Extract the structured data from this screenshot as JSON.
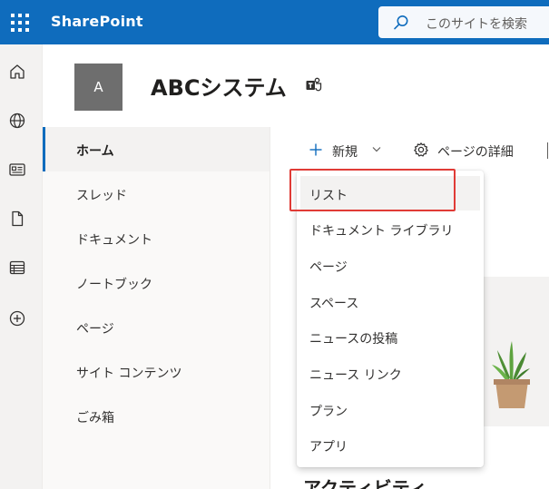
{
  "app": {
    "name": "SharePoint"
  },
  "search": {
    "placeholder": "このサイトを検索"
  },
  "rail": {
    "icons": [
      "home-icon",
      "globe-icon",
      "news-icon",
      "document-icon",
      "list-icon",
      "add-circle-icon"
    ]
  },
  "site": {
    "logo_letter": "A",
    "title": "ABCシステム",
    "teams_icon": "teams-icon"
  },
  "nav": {
    "items": [
      {
        "label": "ホーム",
        "active": true
      },
      {
        "label": "スレッド"
      },
      {
        "label": "ドキュメント"
      },
      {
        "label": "ノートブック"
      },
      {
        "label": "ページ"
      },
      {
        "label": "サイト コンテンツ"
      },
      {
        "label": "ごみ箱"
      }
    ]
  },
  "commandbar": {
    "new_label": "新規",
    "page_details_label": "ページの詳細"
  },
  "new_menu": {
    "items": [
      "リスト",
      "ドキュメント ライブラリ",
      "ページ",
      "スペース",
      "ニュースの投稿",
      "ニュース リンク",
      "プラン",
      "アプリ"
    ],
    "highlighted": "リスト"
  },
  "main": {
    "activity_heading": "アクティビティ"
  },
  "colors": {
    "suite_bar": "#0f6cbd",
    "highlight_box": "#e03b36",
    "active_indicator": "#0f6cbd"
  }
}
